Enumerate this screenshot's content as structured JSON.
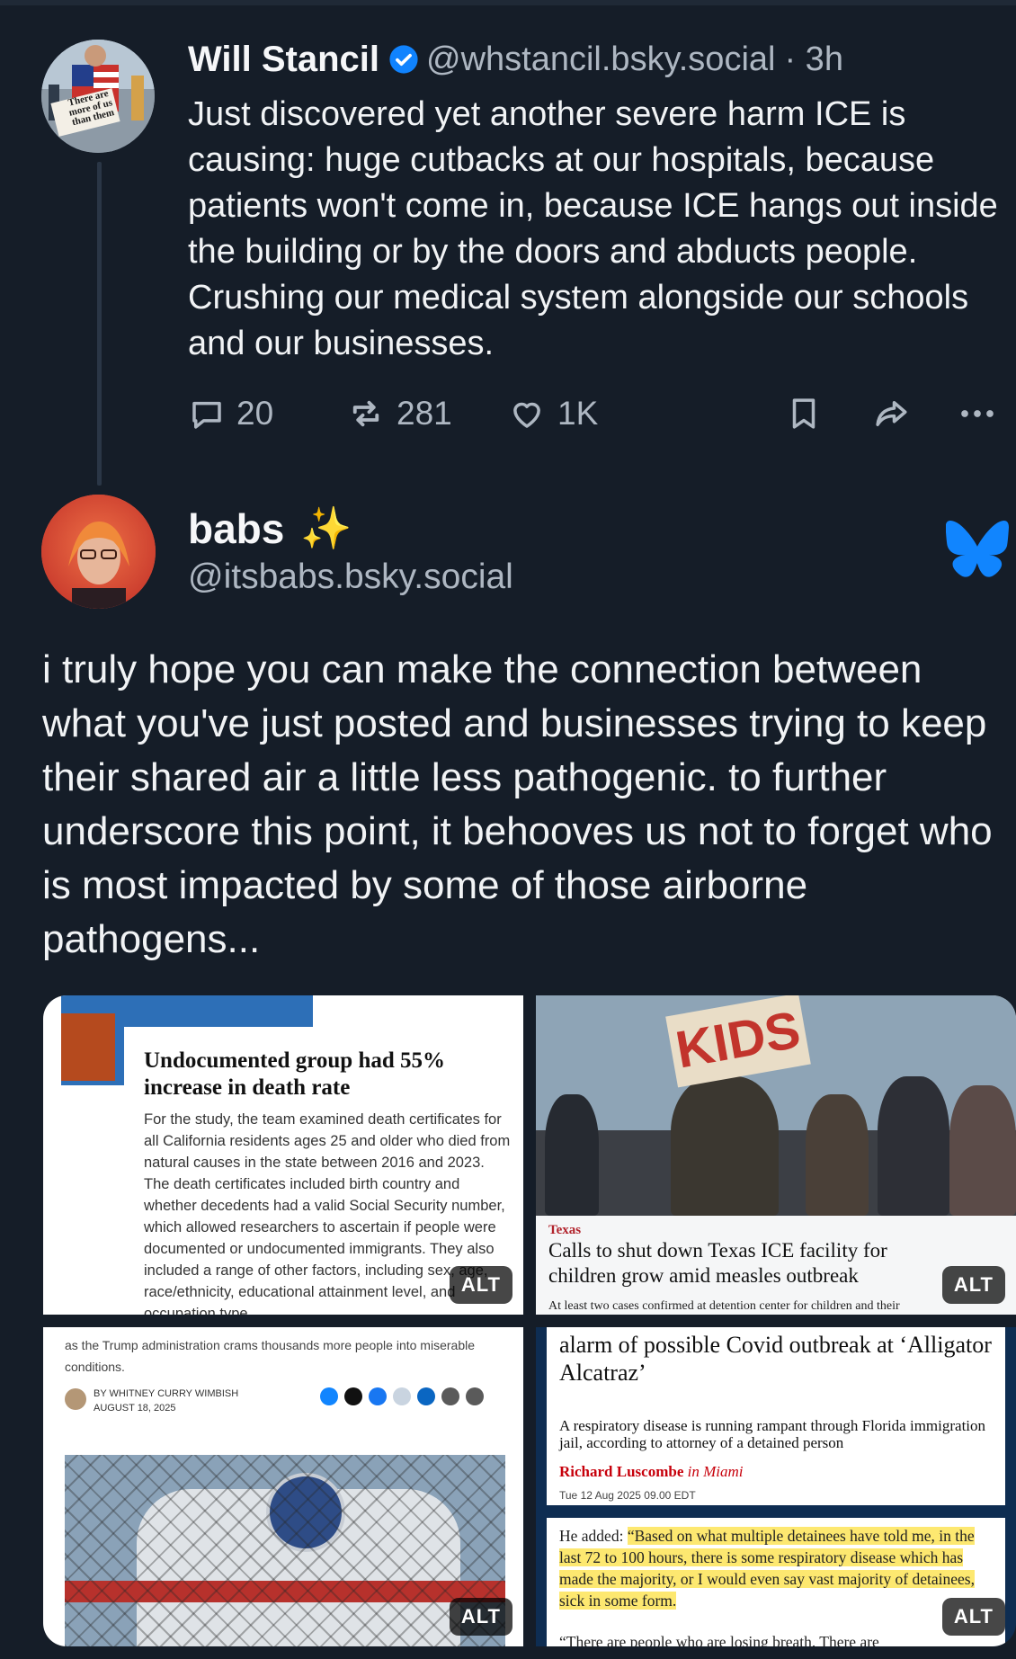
{
  "post1": {
    "author_name": "Will Stancil",
    "handle": "@whstancil.bsky.social",
    "time": "· 3h",
    "avatar_sign_text": "There are more of us than them",
    "text": "Just discovered yet another severe harm ICE is causing: huge cutbacks at our hospitals, because patients won't come in, because ICE hangs out inside the building or by the doors and abducts people. Crushing our medical system alongside our schools and our businesses.",
    "actions": {
      "replies": "20",
      "reposts": "281",
      "likes": "1K"
    }
  },
  "post2": {
    "author_name": "babs",
    "author_emoji": "✨",
    "handle": "@itsbabs.bsky.social",
    "text": "i truly hope you can make the connection between what you've just posted and businesses trying to keep their shared air a little less pathogenic. to further underscore this point, it behooves us not to forget who is most impacted by some of those airborne pathogens..."
  },
  "images": [
    {
      "alt_badge": "ALT",
      "headline": "Undocumented group had 55% increase in death rate",
      "body": "For the study, the team examined death certificates for all California residents ages 25 and older who died from natural causes in the state between 2016 and 2023. The death certificates included birth country and whether decedents had a valid Social Security number, which allowed researchers to ascertain if people were documented or undocumented immigrants. They also included a range of other factors, including sex, age, race/ethnicity, educational attainment level, and occupation type."
    },
    {
      "alt_badge": "ALT",
      "sign_text": "KIDS",
      "section": "Texas",
      "headline": "Calls to shut down Texas ICE facility for children grow amid measles outbreak",
      "subhead": "At least two cases confirmed at detention center for children and their"
    },
    {
      "alt_badge": "ALT",
      "top_text": "as the Trump administration crams thousands more people into miserable conditions.",
      "byline": "BY WHITNEY CURRY WIMBISH",
      "date": "AUGUST 18, 2025"
    },
    {
      "alt_badge": "ALT",
      "headline": "alarm of possible Covid outbreak at ‘Alligator Alcatraz’",
      "subhead": "A respiratory disease is running rampant through Florida immigration jail, according to attorney of a detained person",
      "byline_name": "Richard Luscombe",
      "byline_place": "in Miami",
      "date": "Tue 12 Aug 2025 09.00 EDT",
      "quote_lead": "He added: ",
      "quote_highlight": "“Based on what multiple detainees have told me, in the last 72 to 100 hours, there is some respiratory disease which has made the majority, or I would even say vast majority of detainees, sick in some form.",
      "quote2": "“There are people who are losing breath. There are"
    }
  ],
  "colors": {
    "background": "#151d28",
    "verified": "#1083fe",
    "bluesky": "#1185fe",
    "muted_text": "#aeb7c2"
  }
}
